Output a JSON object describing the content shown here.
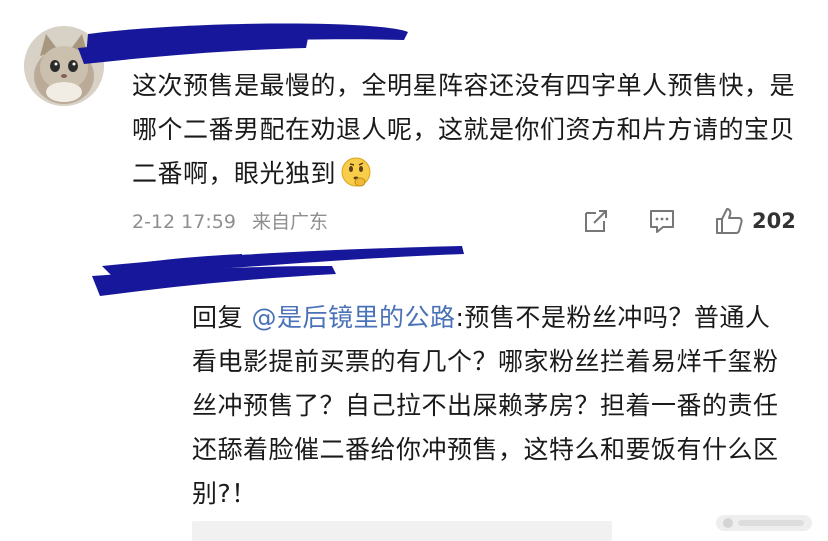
{
  "comment": {
    "text": "这次预售是最慢的，全明星阵容还没有四字单人预售快，是哪个二番男配在劝退人呢，这就是你们资方和片方请的宝贝二番啊，眼光独到",
    "emoji": "thinking-face-icon",
    "time": "2-12 17:59",
    "source": "来自广东",
    "like_count": "202"
  },
  "reply": {
    "prefix": "回复 ",
    "mention": "@是后镜里的公路",
    "text": ":预售不是粉丝冲吗？普通人看电影提前买票的有几个？哪家粉丝拦着易烊千玺粉丝冲预售了？自己拉不出屎赖茅房？担着一番的责任还舔着脸催二番给你冲预售，这特么和要饭有什么区别?！"
  },
  "colors": {
    "redaction": "#16179a",
    "mention": "#4a72b8",
    "meta": "#8f8f8f"
  }
}
